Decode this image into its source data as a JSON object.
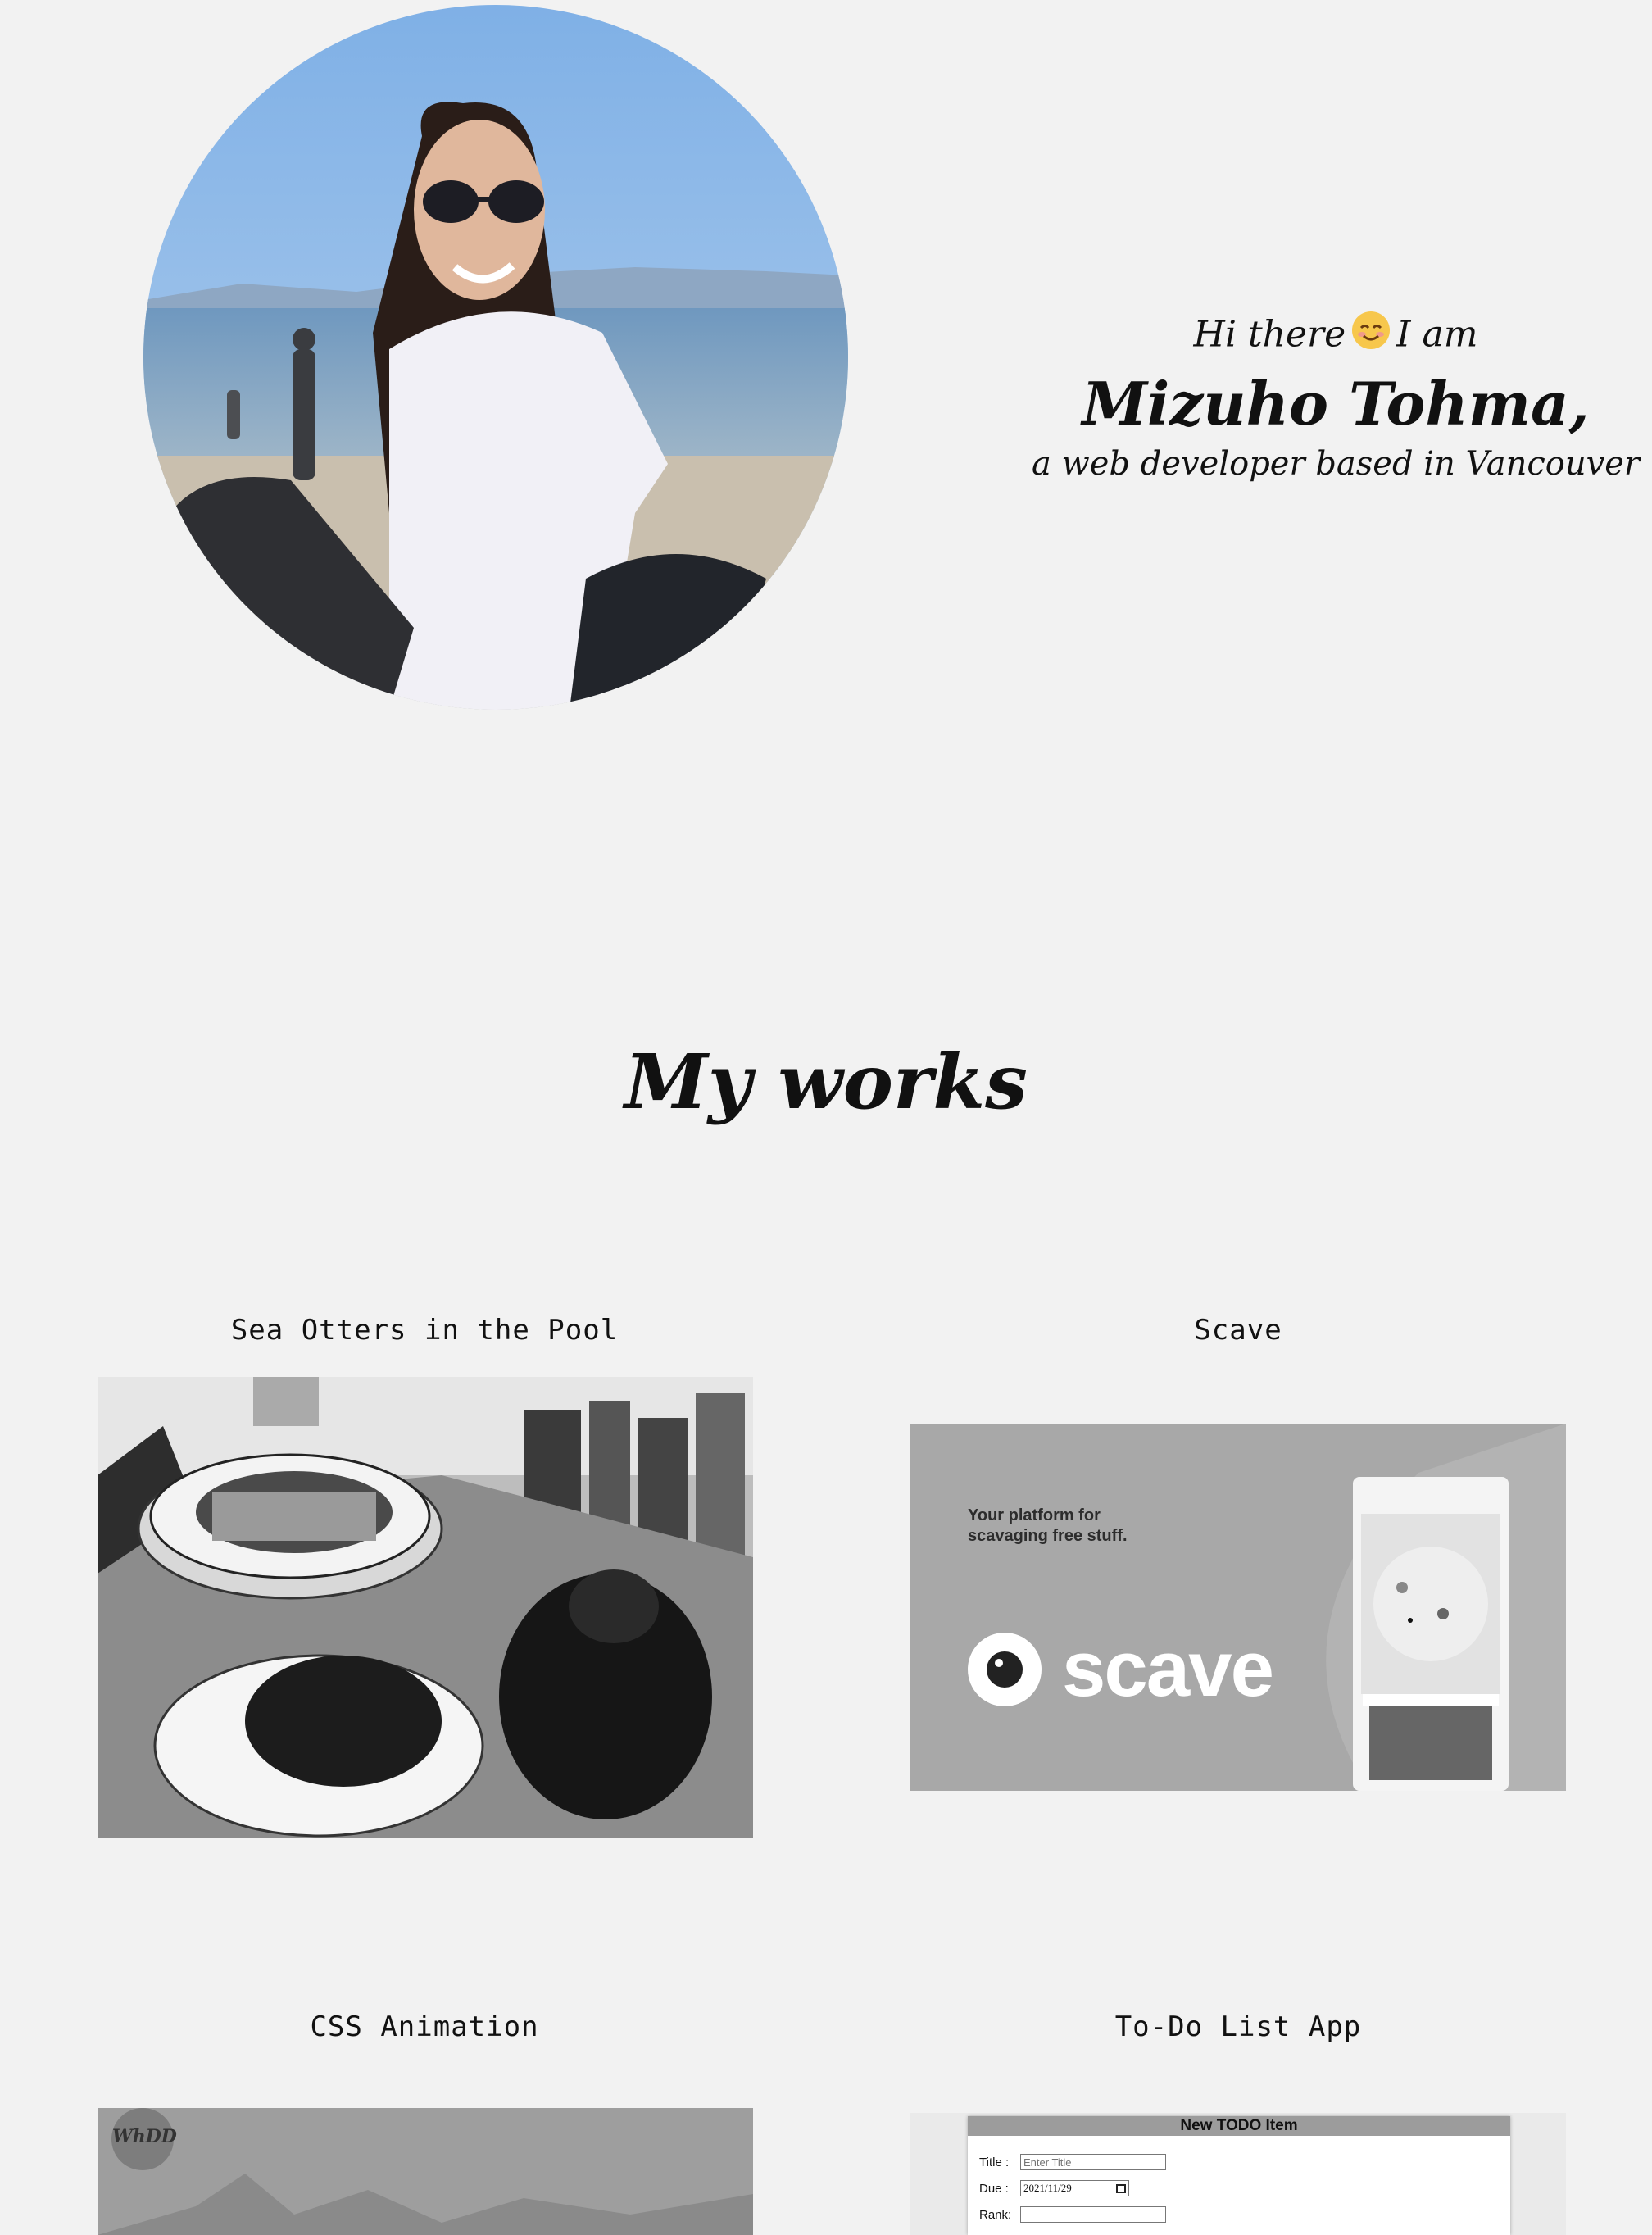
{
  "hero": {
    "greeting_prefix": "Hi there",
    "greeting_suffix": "I am",
    "emoji_icon": "smiling-face-emoji",
    "name": "Mizuho Tohma,",
    "role": "a web developer based in Vancouver"
  },
  "works": {
    "title": "My works",
    "items": [
      {
        "title": "Sea Otters in the Pool"
      },
      {
        "title": "Scave",
        "tagline_line1": "Your platform for",
        "tagline_line2": "scavaging free stuff.",
        "logo_text": "scave"
      },
      {
        "title": "CSS Animation",
        "badge_text": "WhDD"
      },
      {
        "title": "To-Do List App",
        "form_header": "New TODO Item",
        "field_title_label": "Title :",
        "field_title_placeholder": "Enter Title",
        "field_due_label": "Due :",
        "field_due_value": "2021/11/29",
        "field_rank_label": "Rank:"
      }
    ]
  },
  "colors": {
    "background": "#f2f2f2",
    "text": "#111111",
    "scave_bg": "#a8a8a8"
  }
}
